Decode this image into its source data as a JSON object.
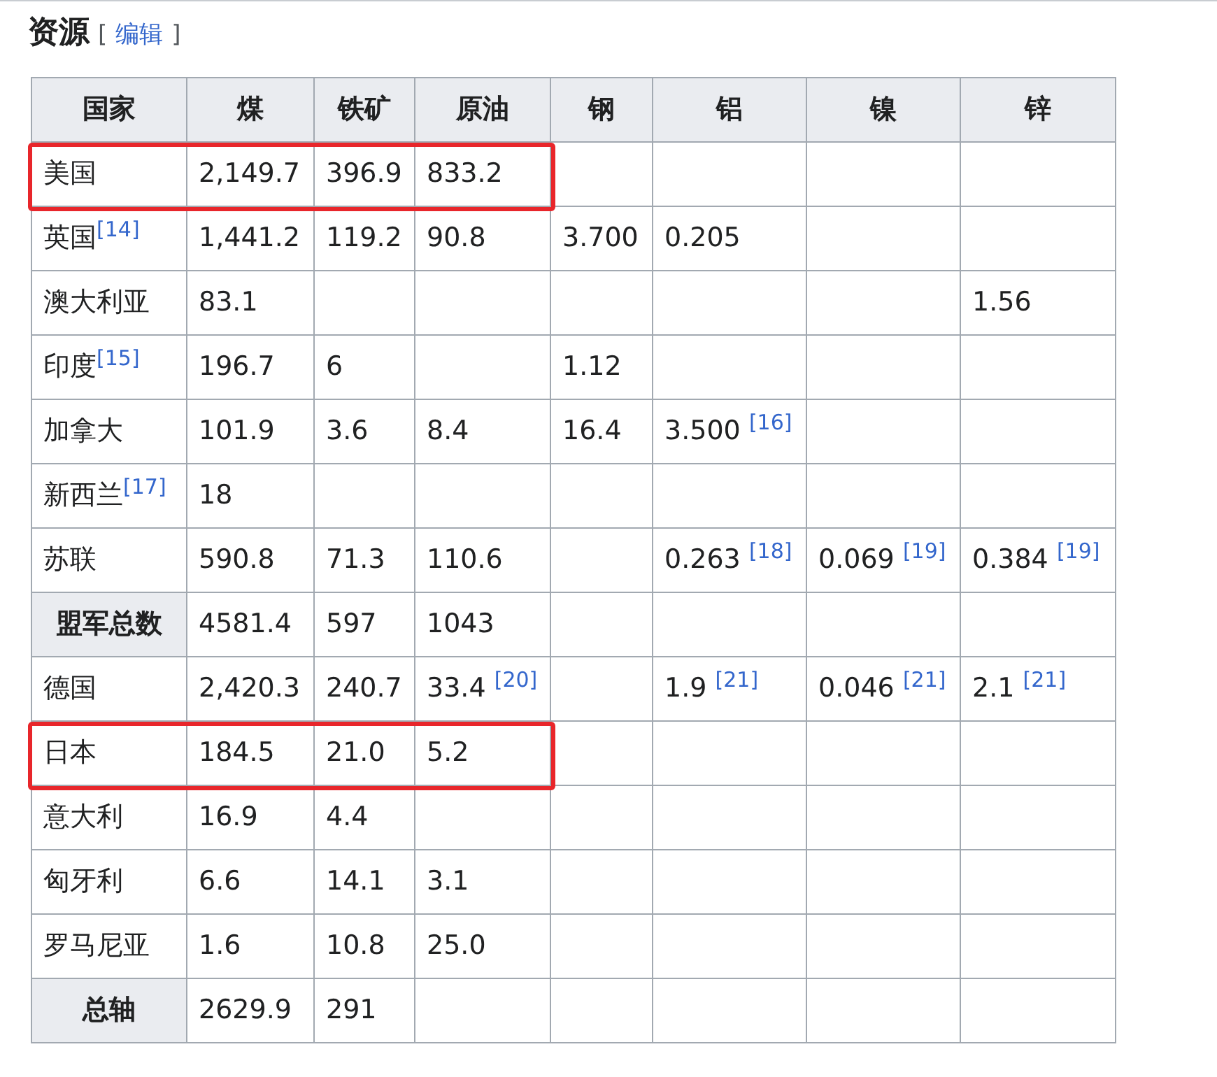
{
  "section": {
    "title": "资源",
    "edit_open": "[",
    "edit_link": "编辑",
    "edit_close": "]"
  },
  "table": {
    "columns": [
      "国家",
      "煤",
      "铁矿",
      "原油",
      "钢",
      "铝",
      "镍",
      "锌"
    ],
    "rows": [
      {
        "kind": "data",
        "highlighted": true,
        "cells": [
          "美国",
          "2,149.7",
          "396.9",
          "833.2",
          "",
          "",
          "",
          ""
        ]
      },
      {
        "kind": "data",
        "highlighted": false,
        "cells": [
          "英国$^{[14]}$",
          "1,441.2",
          "119.2",
          "90.8",
          "3.700",
          "0.205",
          "",
          ""
        ]
      },
      {
        "kind": "data",
        "highlighted": false,
        "cells": [
          "澳大利亚",
          "83.1",
          "",
          "",
          "",
          "",
          "",
          "1.56"
        ]
      },
      {
        "kind": "data",
        "highlighted": false,
        "cells": [
          "印度$^{[15]}$",
          "196.7",
          "6",
          "",
          "1.12",
          "",
          "",
          ""
        ]
      },
      {
        "kind": "data",
        "highlighted": false,
        "cells": [
          "加拿大",
          "101.9",
          "3.6",
          "8.4",
          "16.4",
          "3.500 $^{[16]}$",
          "",
          ""
        ]
      },
      {
        "kind": "data",
        "highlighted": false,
        "cells": [
          "新西兰$^{[17]}$",
          "18",
          "",
          "",
          "",
          "",
          "",
          ""
        ]
      },
      {
        "kind": "data",
        "highlighted": false,
        "cells": [
          "苏联",
          "590.8",
          "71.3",
          "110.6",
          "",
          "0.263 $^{[18]}$",
          "0.069 $^{[19]}$",
          "0.384 $^{[19]}$"
        ]
      },
      {
        "kind": "total",
        "highlighted": false,
        "cells": [
          "盟军总数",
          "4581.4",
          "597",
          "1043",
          "",
          "",
          "",
          ""
        ]
      },
      {
        "kind": "data",
        "highlighted": false,
        "cells": [
          "德国",
          "2,420.3",
          "240.7",
          "33.4 $^{[20]}$",
          "",
          "1.9 $^{[21]}$",
          "0.046 $^{[21]}$",
          "2.1 $^{[21]}$"
        ]
      },
      {
        "kind": "data",
        "highlighted": true,
        "cells": [
          "日本",
          "184.5",
          "21.0",
          "5.2",
          "",
          "",
          "",
          ""
        ]
      },
      {
        "kind": "data",
        "highlighted": false,
        "cells": [
          "意大利",
          "16.9",
          "4.4",
          "",
          "",
          "",
          "",
          ""
        ]
      },
      {
        "kind": "data",
        "highlighted": false,
        "cells": [
          "匈牙利",
          "6.6",
          "14.1",
          "3.1",
          "",
          "",
          "",
          ""
        ]
      },
      {
        "kind": "data",
        "highlighted": false,
        "cells": [
          "罗马尼亚",
          "1.6",
          "10.8",
          "25.0",
          "",
          "",
          "",
          ""
        ]
      },
      {
        "kind": "total",
        "highlighted": false,
        "cells": [
          "总轴",
          "2629.9",
          "291",
          "",
          "",
          "",
          "",
          ""
        ]
      }
    ]
  }
}
